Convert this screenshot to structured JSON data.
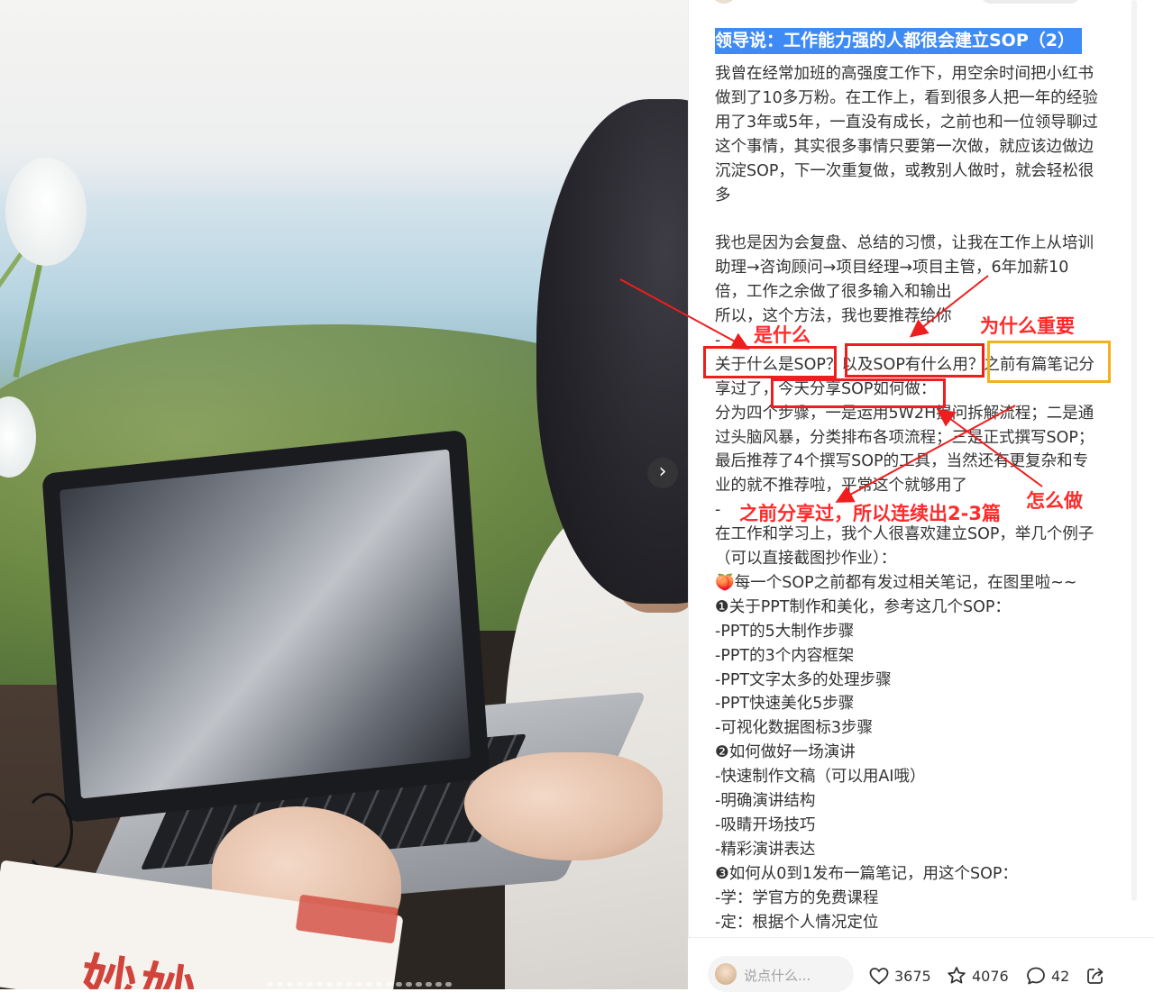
{
  "post": {
    "title": "领导说：工作能力强的人都很会建立SOP（2）",
    "lines": [
      "我曾在经常加班的高强度工作下，用空余时间把小红书",
      "做到了10多万粉。在工作上，看到很多人把一年的经验",
      "用了3年或5年，一直没有成长，之前也和一位领导聊过",
      "这个事情，其实很多事情只要第一次做，就应该边做边",
      "沉淀SOP，下一次重复做，或教别人做时，就会轻松很",
      "多",
      "",
      "我也是因为会复盘、总结的习惯，让我在工作上从培训",
      "助理→咨询顾问→项目经理→项目主管，6年加薪10",
      "倍，工作之余做了很多输入和输出",
      "所以，这个方法，我也要推荐给你",
      "-",
      "关于什么是SOP？以及SOP有什么用？之前有篇笔记分",
      "享过了，今天分享SOP如何做：",
      "分为四个步骤，一是运用5W2H提问拆解流程；二是通",
      "过头脑风暴，分类排布各项流程；三是正式撰写SOP；",
      "最后推荐了4个撰写SOP的工具，当然还有更复杂和专",
      "业的就不推荐啦，平常这个就够用了",
      "-",
      "在工作和学习上，我个人很喜欢建立SOP，举几个例子",
      "（可以直接截图抄作业）：",
      "🍑每一个SOP之前都有发过相关笔记，在图里啦~~",
      "❶关于PPT制作和美化，参考这几个SOP：",
      "-PPT的5大制作步骤",
      "-PPT的3个内容框架",
      "-PPT文字太多的处理步骤",
      "-PPT快速美化5步骤",
      "-可视化数据图标3步骤",
      "❷如何做好一场演讲",
      "-快速制作文稿（可以用AI哦）",
      "-明确演讲结构",
      "-吸睛开场技巧",
      "-精彩演讲表达",
      "❸如何从0到1发布一篇笔记，用这个SOP：",
      "-学：学官方的免费课程",
      "-定：根据个人情况定位"
    ]
  },
  "annotations": {
    "what": "是什么",
    "why": "为什么重要",
    "how": "怎么做",
    "series": "之前分享过，所以连续出2-3篇",
    "red": "#ee1e1e",
    "yellow": "#f1b21a"
  },
  "bottom_bar": {
    "comment_placeholder": "说点什么...",
    "likes": "3675",
    "collects": "4076",
    "comments": "42"
  },
  "icons": [
    "next-arrow-icon",
    "heart-icon",
    "star-icon",
    "comment-icon",
    "share-icon"
  ],
  "colors": {
    "title_highlight": "#3f8bf5",
    "text": "#333333"
  }
}
